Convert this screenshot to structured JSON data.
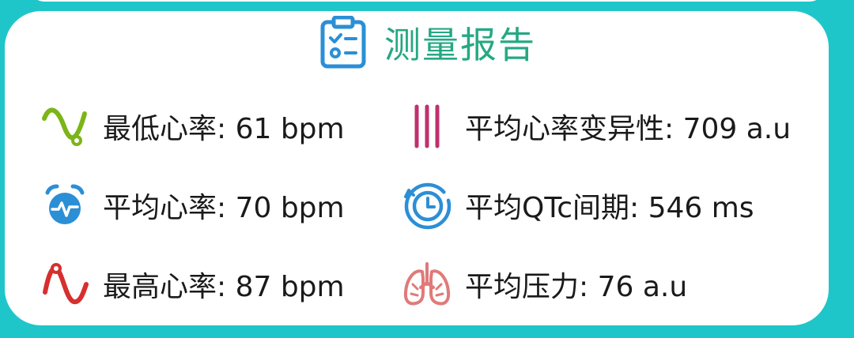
{
  "report": {
    "title": "测量报告",
    "metrics": [
      {
        "label": "最低心率: 61 bpm",
        "icon": "low-wave-icon",
        "color": "#7cb518"
      },
      {
        "label": "平均心率变异性: 709 a.u",
        "icon": "hrv-bars-icon",
        "color": "#c0306f"
      },
      {
        "label": "平均心率: 70 bpm",
        "icon": "heart-alarm-icon",
        "color": "#2b8fd6"
      },
      {
        "label": "平均QTc间期: 546 ms",
        "icon": "clock-timer-icon",
        "color": "#2b8fd6"
      },
      {
        "label": "最高心率: 87 bpm",
        "icon": "high-wave-icon",
        "color": "#d62f2f"
      },
      {
        "label": "平均压力: 76 a.u",
        "icon": "lungs-icon",
        "color": "#e07a7a"
      }
    ]
  }
}
